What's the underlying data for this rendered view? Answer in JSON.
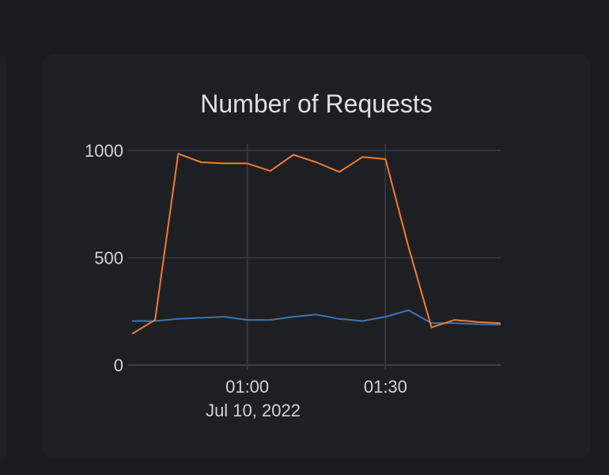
{
  "chart_data": {
    "type": "line",
    "title": "Number of Requests",
    "x": [
      "00:35",
      "00:40",
      "00:45",
      "00:50",
      "00:55",
      "01:00",
      "01:05",
      "01:10",
      "01:15",
      "01:20",
      "01:25",
      "01:30",
      "01:35",
      "01:40",
      "01:45",
      "01:50",
      "01:55"
    ],
    "x_ticks": [
      "01:00",
      "01:30"
    ],
    "x_sublabel": "Jul 10, 2022",
    "y_ticks": [
      "0",
      "500",
      "1000"
    ],
    "ylim": [
      0,
      1030
    ],
    "grid": true,
    "series": [
      {
        "color": "#f07b31",
        "values": [
          145,
          210,
          985,
          945,
          940,
          940,
          905,
          980,
          945,
          900,
          970,
          960,
          550,
          175,
          210,
          200,
          195
        ]
      },
      {
        "color": "#3a76b4",
        "values": [
          205,
          205,
          215,
          220,
          225,
          210,
          210,
          225,
          235,
          215,
          205,
          225,
          255,
          195,
          195,
          190,
          188
        ]
      }
    ]
  }
}
